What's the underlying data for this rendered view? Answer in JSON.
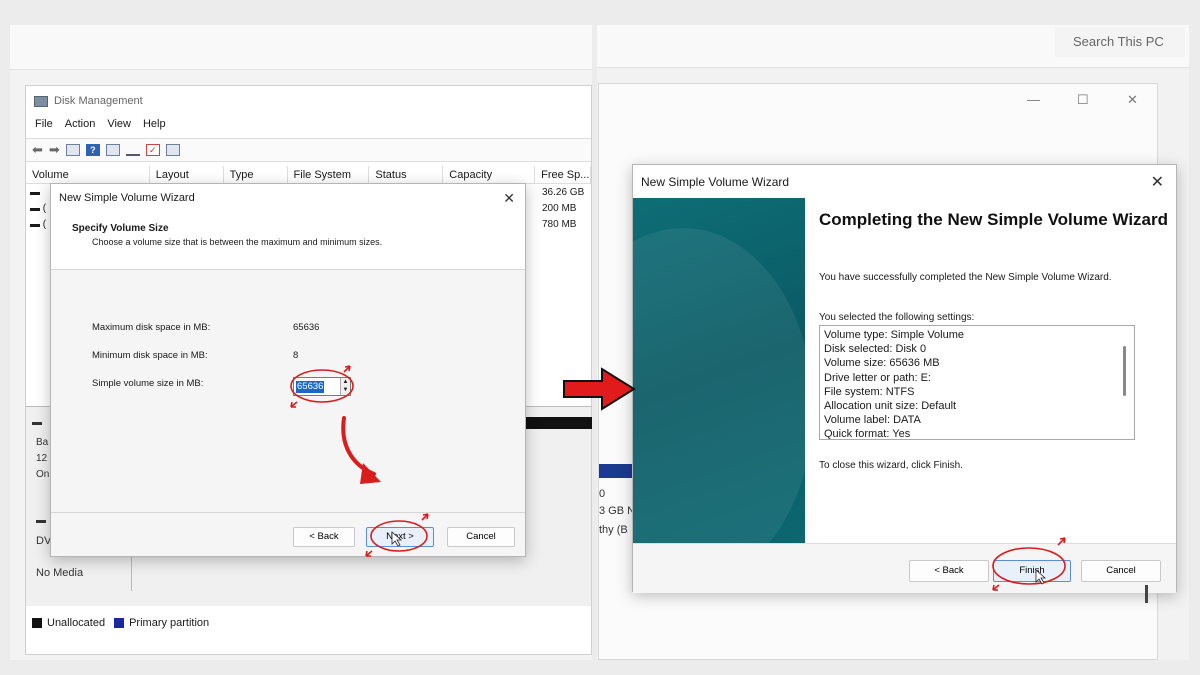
{
  "left": {
    "dm_title": "Disk Management",
    "menu": [
      "File",
      "Action",
      "View",
      "Help"
    ],
    "columns": [
      "Volume",
      "Layout",
      "Type",
      "File System",
      "Status",
      "Capacity",
      "Free Sp..."
    ],
    "free_space": [
      "36.26 GB",
      "200 MB",
      "780 MB"
    ],
    "disk_labels": [
      "Ba",
      "12",
      "On"
    ],
    "cd_label": "DV",
    "no_media": "No Media",
    "legend": [
      {
        "label": "Unallocated",
        "color": "#111111"
      },
      {
        "label": "Primary partition",
        "color": "#1a2a9e"
      }
    ],
    "wizard": {
      "title": "New Simple Volume Wizard",
      "heading": "Specify Volume Size",
      "subheading": "Choose a volume size that is between the maximum and minimum sizes.",
      "max_label": "Maximum disk space in MB:",
      "max_value": "65636",
      "min_label": "Minimum disk space in MB:",
      "min_value": "8",
      "size_label": "Simple volume size in MB:",
      "size_value": "65636",
      "back": "< Back",
      "next": "Next >",
      "cancel": "Cancel"
    }
  },
  "right": {
    "search_placeholder": "Search This PC",
    "explorer_frag": [
      "0",
      "3 GB N",
      "thy (B"
    ],
    "wizard": {
      "title": "New Simple Volume Wizard",
      "heading": "Completing the New Simple Volume Wizard",
      "success": "You have successfully completed the New Simple Volume Wizard.",
      "settings_intro": "You selected the following settings:",
      "settings": [
        "Volume type: Simple Volume",
        "Disk selected: Disk 0",
        "Volume size: 65636 MB",
        "Drive letter or path: E:",
        "File system: NTFS",
        "Allocation unit size: Default",
        "Volume label: DATA",
        "Quick format: Yes"
      ],
      "close_hint": "To close this wizard, click Finish.",
      "back": "< Back",
      "finish": "Finish",
      "cancel": "Cancel"
    }
  },
  "colors": {
    "annotation_red": "#d91c1c",
    "wizard_side": "#0e6d76",
    "selection_blue": "#1c66c7"
  }
}
